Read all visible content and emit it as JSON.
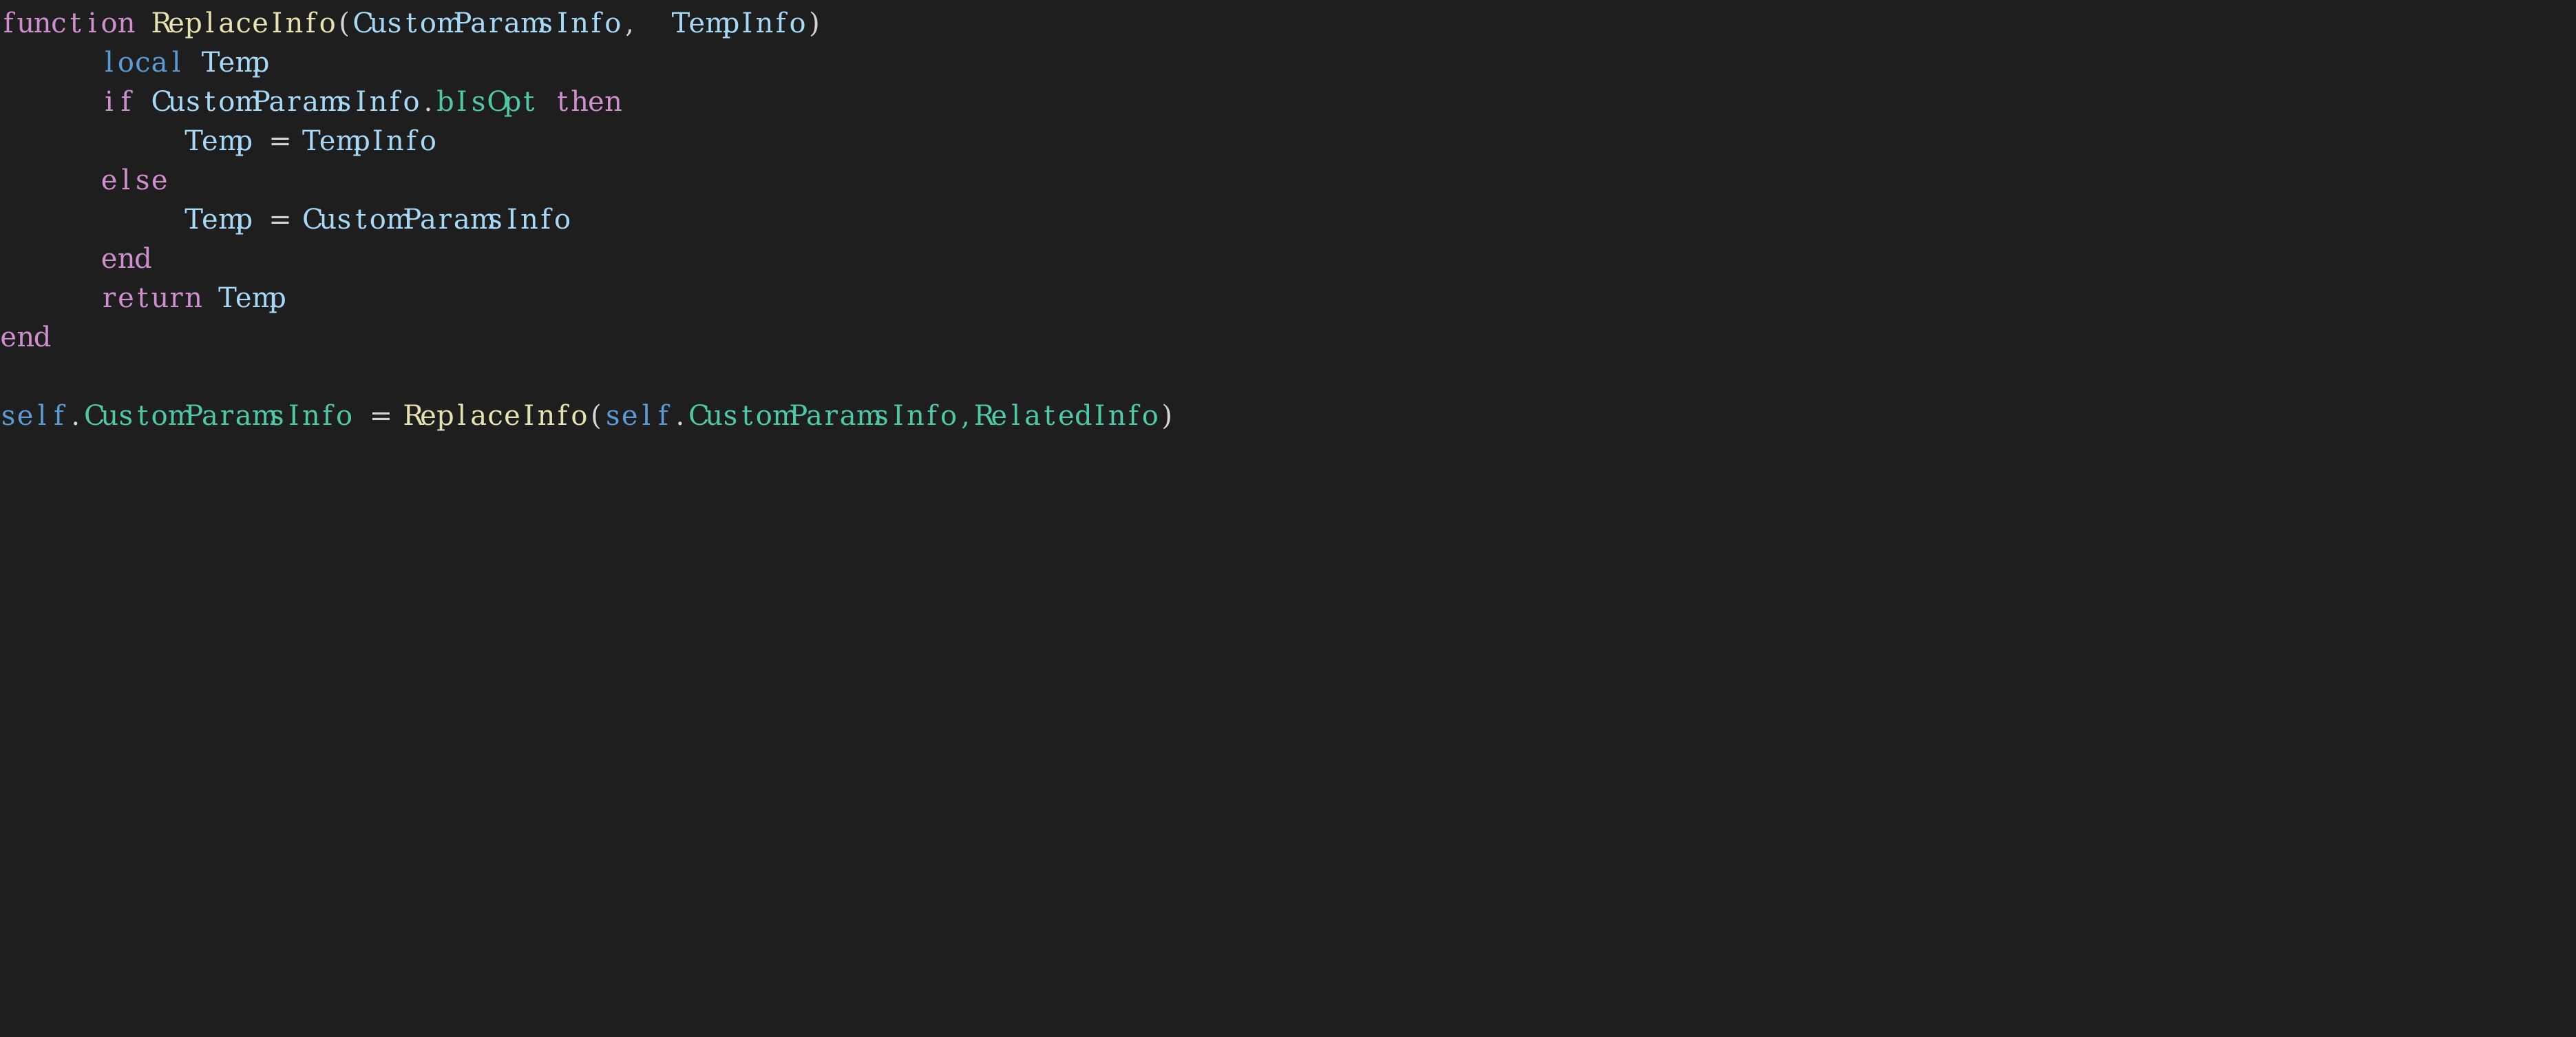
{
  "editor": {
    "language": "lua",
    "background_color": "#1e1e1e",
    "font_size_px": 40,
    "line_height_px": 57,
    "theme_colors": {
      "keyword": "#cf8fcf",
      "storage": "#5b9bd5",
      "function_name": "#e6e2b0",
      "variable": "#a6d9f7",
      "property": "#4ec9a8",
      "punctuation": "#d4d4d4",
      "operator": "#d4d4d4"
    }
  },
  "code": {
    "lines": [
      {
        "index": 0,
        "indent": 0,
        "text": "function ReplaceInfo(CustomParamsInfo, TempInfo)",
        "tokens": [
          {
            "t": "function",
            "c": "keyword"
          },
          {
            "t": " ",
            "c": "plain"
          },
          {
            "t": "ReplaceInfo",
            "c": "function"
          },
          {
            "t": "(",
            "c": "punct"
          },
          {
            "t": "CustomParamsInfo",
            "c": "variable"
          },
          {
            "t": ",",
            "c": "punct"
          },
          {
            "t": "  ",
            "c": "plain"
          },
          {
            "t": "TempInfo",
            "c": "variable"
          },
          {
            "t": ")",
            "c": "punct"
          }
        ]
      },
      {
        "index": 1,
        "indent": 1,
        "text": "local Temp",
        "tokens": [
          {
            "t": "      ",
            "c": "plain"
          },
          {
            "t": "local",
            "c": "storage"
          },
          {
            "t": " ",
            "c": "plain"
          },
          {
            "t": "Temp",
            "c": "variable"
          }
        ]
      },
      {
        "index": 2,
        "indent": 1,
        "text": "if CustomParamsInfo.bIsOpt then",
        "tokens": [
          {
            "t": "      ",
            "c": "plain"
          },
          {
            "t": "if",
            "c": "keyword"
          },
          {
            "t": " ",
            "c": "plain"
          },
          {
            "t": "CustomParamsInfo",
            "c": "variable"
          },
          {
            "t": ".",
            "c": "punct"
          },
          {
            "t": "bIsOpt",
            "c": "property"
          },
          {
            "t": " ",
            "c": "plain"
          },
          {
            "t": "then",
            "c": "keyword"
          }
        ]
      },
      {
        "index": 3,
        "indent": 2,
        "text": "Temp = TempInfo",
        "tokens": [
          {
            "t": "           ",
            "c": "plain"
          },
          {
            "t": "Temp",
            "c": "variable"
          },
          {
            "t": " ",
            "c": "plain"
          },
          {
            "t": "=",
            "c": "operator"
          },
          {
            "t": " ",
            "c": "plain"
          },
          {
            "t": "TempInfo",
            "c": "variable"
          }
        ]
      },
      {
        "index": 4,
        "indent": 1,
        "text": "else",
        "tokens": [
          {
            "t": "      ",
            "c": "plain"
          },
          {
            "t": "else",
            "c": "keyword"
          }
        ]
      },
      {
        "index": 5,
        "indent": 2,
        "text": "Temp = CustomParamsInfo",
        "tokens": [
          {
            "t": "           ",
            "c": "plain"
          },
          {
            "t": "Temp",
            "c": "variable"
          },
          {
            "t": " ",
            "c": "plain"
          },
          {
            "t": "=",
            "c": "operator"
          },
          {
            "t": " ",
            "c": "plain"
          },
          {
            "t": "CustomParamsInfo",
            "c": "variable"
          }
        ]
      },
      {
        "index": 6,
        "indent": 1,
        "text": "end",
        "tokens": [
          {
            "t": "      ",
            "c": "plain"
          },
          {
            "t": "end",
            "c": "keyword"
          }
        ]
      },
      {
        "index": 7,
        "indent": 1,
        "text": "return Temp",
        "tokens": [
          {
            "t": "      ",
            "c": "plain"
          },
          {
            "t": "return",
            "c": "keyword"
          },
          {
            "t": " ",
            "c": "plain"
          },
          {
            "t": "Temp",
            "c": "variable"
          }
        ]
      },
      {
        "index": 8,
        "indent": 0,
        "text": "end",
        "tokens": [
          {
            "t": "end",
            "c": "keyword"
          }
        ]
      },
      {
        "index": 9,
        "indent": 0,
        "text": "",
        "tokens": []
      },
      {
        "index": 10,
        "indent": 0,
        "text": "self.CustomParamsInfo = ReplaceInfo(self.CustomParamsInfo,RelatedInfo)",
        "tokens": [
          {
            "t": "self",
            "c": "storage"
          },
          {
            "t": ".",
            "c": "punct"
          },
          {
            "t": "CustomParamsInfo",
            "c": "property"
          },
          {
            "t": " ",
            "c": "plain"
          },
          {
            "t": "=",
            "c": "operator"
          },
          {
            "t": " ",
            "c": "plain"
          },
          {
            "t": "ReplaceInfo",
            "c": "function"
          },
          {
            "t": "(",
            "c": "punct"
          },
          {
            "t": "self",
            "c": "storage"
          },
          {
            "t": ".",
            "c": "punct"
          },
          {
            "t": "CustomParamsInfo",
            "c": "property"
          },
          {
            "t": ",",
            "c": "property"
          },
          {
            "t": "RelatedInfo",
            "c": "property"
          },
          {
            "t": ")",
            "c": "punct"
          }
        ]
      }
    ]
  }
}
